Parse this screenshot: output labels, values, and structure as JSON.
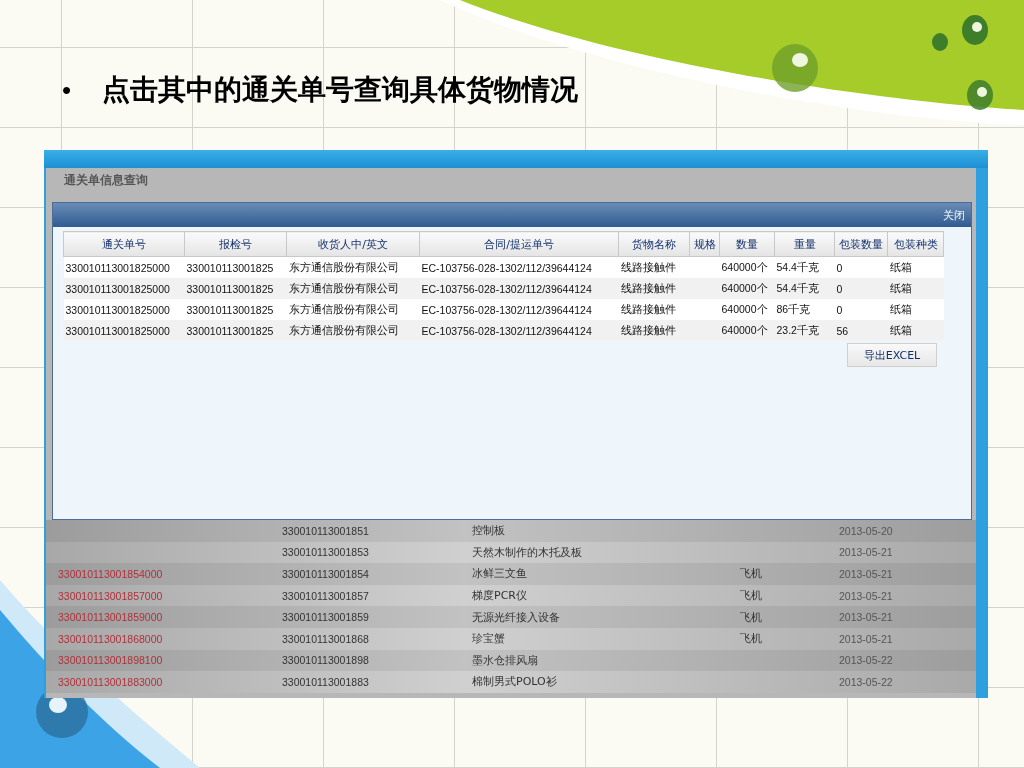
{
  "slide": {
    "marker": "•",
    "bullet": "点击其中的通关单号查询具体货物情况"
  },
  "screen": {
    "page_title": "通关单信息查询",
    "modal": {
      "close": "关闭",
      "columns": [
        "通关单号",
        "报检号",
        "收货人中/英文",
        "合同/提运单号",
        "货物名称",
        "规格",
        "数量",
        "重量",
        "包装数量",
        "包装种类"
      ],
      "rows": [
        [
          "330010113001825000",
          "330010113001825",
          "东方通信股份有限公司",
          "EC-103756-028-1302/112/39644124",
          "线路接触件",
          "",
          "640000个",
          "54.4千克",
          "0",
          "纸箱"
        ],
        [
          "330010113001825000",
          "330010113001825",
          "东方通信股份有限公司",
          "EC-103756-028-1302/112/39644124",
          "线路接触件",
          "",
          "640000个",
          "54.4千克",
          "0",
          "纸箱"
        ],
        [
          "330010113001825000",
          "330010113001825",
          "东方通信股份有限公司",
          "EC-103756-028-1302/112/39644124",
          "线路接触件",
          "",
          "640000个",
          "86千克",
          "0",
          "纸箱"
        ],
        [
          "330010113001825000",
          "330010113001825",
          "东方通信股份有限公司",
          "EC-103756-028-1302/112/39644124",
          "线路接触件",
          "",
          "640000个",
          "23.2千克",
          "56",
          "纸箱"
        ]
      ],
      "export_button": "导出EXCEL"
    },
    "background_table": {
      "rows": [
        {
          "column_2": "330010113001851",
          "column_3": "控制板",
          "column_5": "2013-05-20"
        },
        {
          "column_2": "330010113001853",
          "column_3": "天然木制作的木托及板",
          "column_5": "2013-05-21"
        },
        {
          "column_1": "330010113001854000",
          "column_2": "330010113001854",
          "column_3": "冰鲜三文鱼",
          "column_4": "飞机",
          "column_5": "2013-05-21"
        },
        {
          "column_1": "330010113001857000",
          "column_2": "330010113001857",
          "column_3": "梯度PCR仪",
          "column_4": "飞机",
          "column_5": "2013-05-21"
        },
        {
          "column_1": "330010113001859000",
          "column_2": "330010113001859",
          "column_3": "无源光纤接入设备",
          "column_4": "飞机",
          "column_5": "2013-05-21"
        },
        {
          "column_1": "330010113001868000",
          "column_2": "330010113001868",
          "column_3": "珍宝蟹",
          "column_4": "飞机",
          "column_5": "2013-05-21"
        },
        {
          "column_1": "330010113001898100",
          "column_2": "330010113001898",
          "column_3": "墨水仓排风扇",
          "column_5": "2013-05-22"
        },
        {
          "column_1": "330010113001883000",
          "column_2": "330010113001883",
          "column_3": "棉制男式POLO衫",
          "column_5": "2013-05-22"
        }
      ]
    }
  }
}
